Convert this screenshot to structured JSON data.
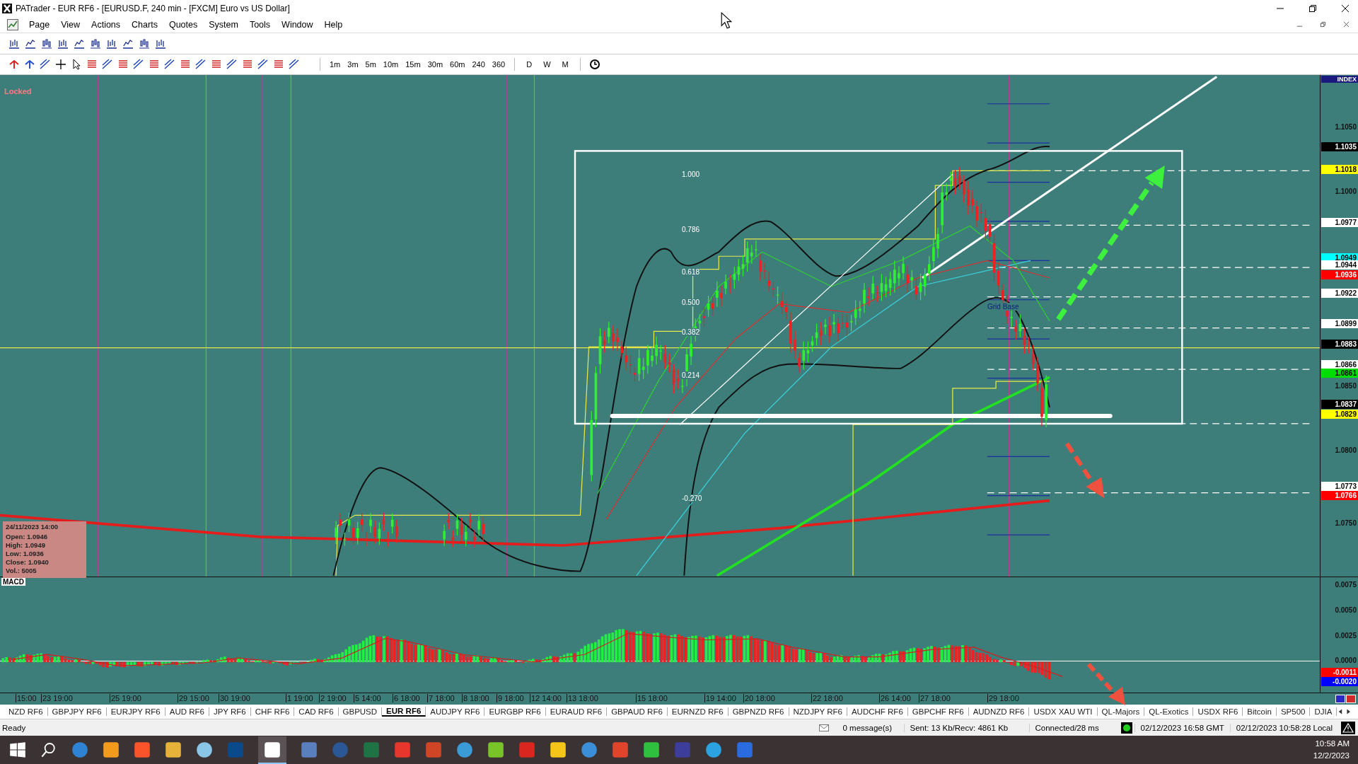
{
  "window": {
    "title": "PATrader - EUR RF6 - [EURUSD.F, 240 min - [FXCM] Euro vs US Dollar]"
  },
  "menu": [
    "Page",
    "View",
    "Actions",
    "Charts",
    "Quotes",
    "System",
    "Tools",
    "Window",
    "Help"
  ],
  "timeframes": [
    {
      "label": "1m",
      "kind": "minute"
    },
    {
      "label": "3m",
      "kind": "minute"
    },
    {
      "label": "5m",
      "kind": "minute"
    },
    {
      "label": "10m",
      "kind": "minute"
    },
    {
      "label": "15m",
      "kind": "minute"
    },
    {
      "label": "30m",
      "kind": "minute"
    },
    {
      "label": "60m",
      "kind": "minute"
    },
    {
      "label": "240",
      "kind": "minute"
    },
    {
      "label": "360",
      "kind": "minute"
    },
    {
      "label": "D",
      "kind": "period"
    },
    {
      "label": "W",
      "kind": "period"
    },
    {
      "label": "M",
      "kind": "period"
    }
  ],
  "chart": {
    "lock_label": "Locked",
    "grid_base": "Grid Base",
    "fib_levels": [
      "1.000",
      "0.786",
      "0.618",
      "0.500",
      "0.382",
      "0.214",
      "-0.270"
    ],
    "data_box": {
      "date": "24/11/2023 14:00",
      "lines": [
        "Open: 1.0946",
        "High: 1.0949",
        "Low: 1.0936",
        "Close: 1.0940",
        "Vol.: 5005"
      ]
    },
    "axis_title": "INDEX",
    "price_axis": [
      {
        "text": "1.1050",
        "kind": "tick"
      },
      {
        "text": "1.1035",
        "kind": "marker",
        "color": "#000000"
      },
      {
        "text": "1.1018",
        "kind": "marker",
        "color": "#ffff00"
      },
      {
        "text": "1.1000",
        "kind": "tick"
      },
      {
        "text": "1.0977",
        "kind": "marker",
        "color": "#ffffff"
      },
      {
        "text": "1.0949",
        "kind": "marker",
        "color": "#00ffff"
      },
      {
        "text": "1.0944",
        "kind": "marker",
        "color": "#ffffff"
      },
      {
        "text": "1.0936",
        "kind": "marker",
        "color": "#ff0000"
      },
      {
        "text": "1.0922",
        "kind": "marker",
        "color": "#ffffff"
      },
      {
        "text": "1.0899",
        "kind": "marker",
        "color": "#ffffff"
      },
      {
        "text": "1.0883",
        "kind": "marker",
        "color": "#000000"
      },
      {
        "text": "1.0866",
        "kind": "marker",
        "color": "#ffffff"
      },
      {
        "text": "1.0861",
        "kind": "marker",
        "color": "#00dd00"
      },
      {
        "text": "1.0850",
        "kind": "tick"
      },
      {
        "text": "1.0837",
        "kind": "marker",
        "color": "#000000"
      },
      {
        "text": "1.0829",
        "kind": "marker",
        "color": "#ffff00"
      },
      {
        "text": "1.0800",
        "kind": "tick"
      },
      {
        "text": "1.0773",
        "kind": "marker",
        "color": "#ffffff"
      },
      {
        "text": "1.0766",
        "kind": "marker",
        "color": "#ff0000"
      },
      {
        "text": "1.0750",
        "kind": "tick"
      }
    ]
  },
  "macd": {
    "label": "MACD",
    "axis": [
      {
        "text": "0.0075",
        "kind": "tick"
      },
      {
        "text": "0.0050",
        "kind": "tick"
      },
      {
        "text": "0.0025",
        "kind": "tick"
      },
      {
        "text": "0.0000",
        "kind": "tick"
      },
      {
        "text": "-0.0011",
        "kind": "marker",
        "color": "#ff0000"
      },
      {
        "text": "-0.0020",
        "kind": "marker",
        "color": "#0000ff"
      }
    ]
  },
  "time_axis": [
    "15:00",
    "23 19:00",
    "25 19:00",
    "29 15:00",
    "30 19:00",
    "1 19:00",
    "2 19:00",
    "5 14:00",
    "6 18:00",
    "7 18:00",
    "8 18:00",
    "9 18:00",
    "12 14:00",
    "13 18:00",
    "15 18:00",
    "19 14:00",
    "20 18:00",
    "22 18:00",
    "26 14:00",
    "27 18:00",
    "29 18:00"
  ],
  "tabs": [
    {
      "label": "NZD RF6",
      "selected": false
    },
    {
      "label": "GBPJPY RF6",
      "selected": false
    },
    {
      "label": "EURJPY RF6",
      "selected": false
    },
    {
      "label": "AUD RF6",
      "selected": false
    },
    {
      "label": "JPY RF6",
      "selected": false
    },
    {
      "label": "CHF RF6",
      "selected": false
    },
    {
      "label": "CAD RF6",
      "selected": false
    },
    {
      "label": "GBPUSD",
      "selected": false
    },
    {
      "label": "EUR RF6",
      "selected": true
    },
    {
      "label": "AUDJPY RF6",
      "selected": false
    },
    {
      "label": "EURGBP RF6",
      "selected": false
    },
    {
      "label": "EURAUD RF6",
      "selected": false
    },
    {
      "label": "GBPAUD RF6",
      "selected": false
    },
    {
      "label": "EURNZD RF6",
      "selected": false
    },
    {
      "label": "GBPNZD RF6",
      "selected": false
    },
    {
      "label": "NZDJPY RF6",
      "selected": false
    },
    {
      "label": "AUDCHF RF6",
      "selected": false
    },
    {
      "label": "GBPCHF RF6",
      "selected": false
    },
    {
      "label": "AUDNZD RF6",
      "selected": false
    },
    {
      "label": "USDX XAU WTI",
      "selected": false
    },
    {
      "label": "QL-Majors",
      "selected": false
    },
    {
      "label": "QL-Exotics",
      "selected": false
    },
    {
      "label": "USDX RF6",
      "selected": false
    },
    {
      "label": "Bitcoin",
      "selected": false
    },
    {
      "label": "SP500",
      "selected": false
    },
    {
      "label": "DJIA",
      "selected": false
    }
  ],
  "status_bar": {
    "state": "Ready",
    "messages": "0 message(s)",
    "traffic": "Sent: 13 Kb/Recv: 4861 Kb",
    "connection": "Connected/28 ms",
    "gmt_time": "02/12/2023 16:58 GMT",
    "local_time": "02/12/2023 10:58:28 Local"
  },
  "taskbar": {
    "time": "10:58 AM",
    "date": "12/2/2023"
  }
}
